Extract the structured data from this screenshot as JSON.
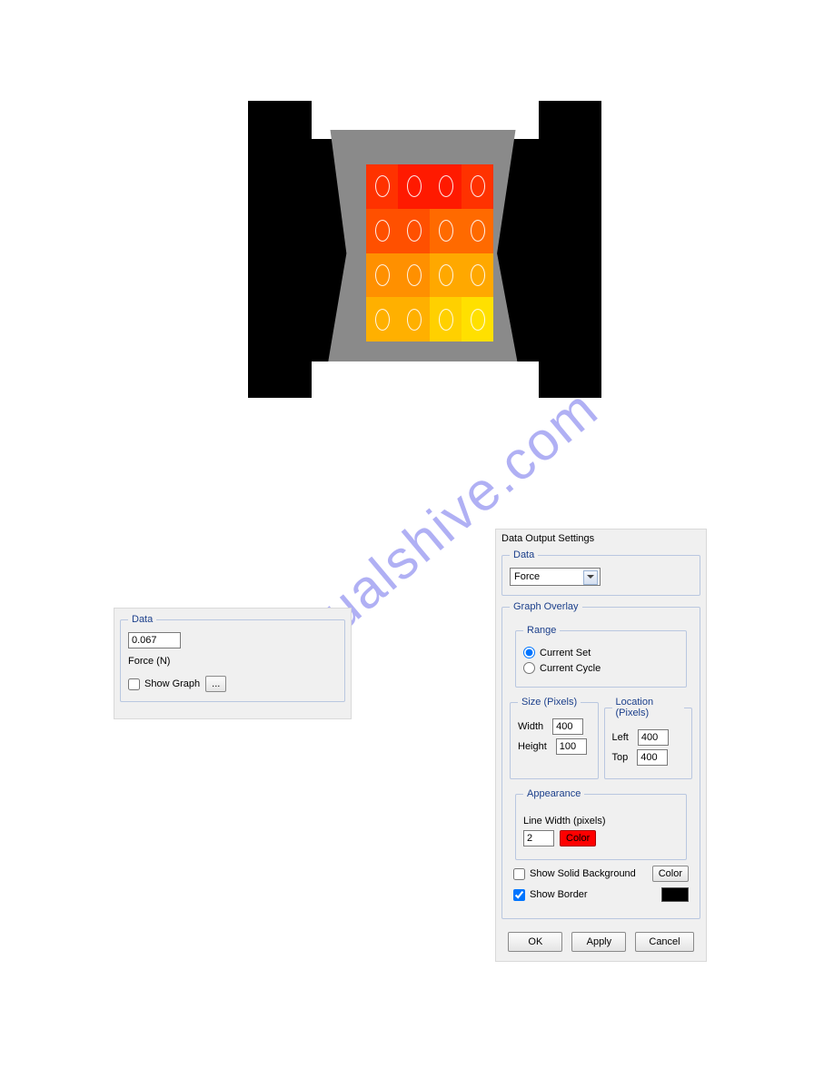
{
  "watermark": "manualshive.com",
  "mini": {
    "legend": "Data",
    "value": "0.067",
    "unit_label": "Force (N)",
    "show_graph_label": "Show Graph",
    "show_graph_checked": false,
    "more_button": "..."
  },
  "dialog": {
    "title": "Data Output Settings",
    "data": {
      "legend": "Data",
      "selected": "Force"
    },
    "overlay": {
      "legend": "Graph Overlay",
      "range": {
        "legend": "Range",
        "current_set": "Current Set",
        "current_cycle": "Current Cycle",
        "selected": "Current Set"
      },
      "size": {
        "legend": "Size (Pixels)",
        "width_label": "Width",
        "width": "400",
        "height_label": "Height",
        "height": "100"
      },
      "location": {
        "legend": "Location (Pixels)",
        "left_label": "Left",
        "left": "400",
        "top_label": "Top",
        "top": "400"
      },
      "appearance": {
        "legend": "Appearance",
        "line_width_label": "Line Width (pixels)",
        "line_width": "2",
        "color_button": "Color",
        "line_color": "#ff0000"
      },
      "background": {
        "show_bg_label": "Show Solid Background",
        "show_bg_checked": false,
        "bg_color_button": "Color",
        "show_border_label": "Show Border",
        "show_border_checked": true,
        "border_color": "#000000"
      }
    },
    "buttons": {
      "ok": "OK",
      "apply": "Apply",
      "cancel": "Cancel"
    }
  }
}
